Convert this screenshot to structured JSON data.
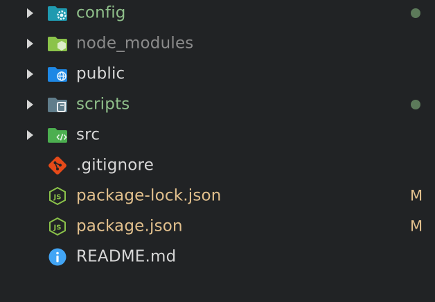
{
  "colors": {
    "background": "#212325",
    "modified_folder": "#8fbf8a",
    "ignored": "#8b8b8b",
    "default_text": "#d7d7d7",
    "modified_file": "#e2c08d",
    "modified_dot": "#5c7a5a"
  },
  "explorer": {
    "items": [
      {
        "label": "config",
        "type": "folder",
        "icon": "folder-config-icon",
        "status": "modified-dot"
      },
      {
        "label": "node_modules",
        "type": "folder",
        "icon": "folder-node-icon",
        "status": "ignored"
      },
      {
        "label": "public",
        "type": "folder",
        "icon": "folder-public-icon",
        "status": ""
      },
      {
        "label": "scripts",
        "type": "folder",
        "icon": "folder-scripts-icon",
        "status": "modified-dot"
      },
      {
        "label": "src",
        "type": "folder",
        "icon": "folder-src-icon",
        "status": ""
      },
      {
        "label": ".gitignore",
        "type": "file",
        "icon": "git-icon",
        "status": ""
      },
      {
        "label": "package-lock.json",
        "type": "file",
        "icon": "nodejs-icon",
        "status": "M"
      },
      {
        "label": "package.json",
        "type": "file",
        "icon": "nodejs-icon",
        "status": "M"
      },
      {
        "label": "README.md",
        "type": "file",
        "icon": "info-icon",
        "status": ""
      }
    ]
  }
}
